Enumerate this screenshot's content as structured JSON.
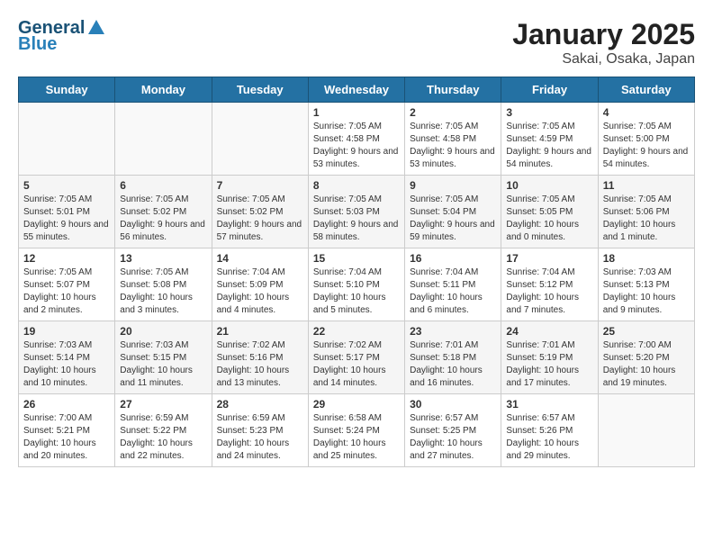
{
  "header": {
    "logo_line1": "General",
    "logo_line2": "Blue",
    "title": "January 2025",
    "subtitle": "Sakai, Osaka, Japan"
  },
  "days_of_week": [
    "Sunday",
    "Monday",
    "Tuesday",
    "Wednesday",
    "Thursday",
    "Friday",
    "Saturday"
  ],
  "weeks": [
    [
      {
        "day": "",
        "sunrise": "",
        "sunset": "",
        "daylight": ""
      },
      {
        "day": "",
        "sunrise": "",
        "sunset": "",
        "daylight": ""
      },
      {
        "day": "",
        "sunrise": "",
        "sunset": "",
        "daylight": ""
      },
      {
        "day": "1",
        "sunrise": "Sunrise: 7:05 AM",
        "sunset": "Sunset: 4:58 PM",
        "daylight": "Daylight: 9 hours and 53 minutes."
      },
      {
        "day": "2",
        "sunrise": "Sunrise: 7:05 AM",
        "sunset": "Sunset: 4:58 PM",
        "daylight": "Daylight: 9 hours and 53 minutes."
      },
      {
        "day": "3",
        "sunrise": "Sunrise: 7:05 AM",
        "sunset": "Sunset: 4:59 PM",
        "daylight": "Daylight: 9 hours and 54 minutes."
      },
      {
        "day": "4",
        "sunrise": "Sunrise: 7:05 AM",
        "sunset": "Sunset: 5:00 PM",
        "daylight": "Daylight: 9 hours and 54 minutes."
      }
    ],
    [
      {
        "day": "5",
        "sunrise": "Sunrise: 7:05 AM",
        "sunset": "Sunset: 5:01 PM",
        "daylight": "Daylight: 9 hours and 55 minutes."
      },
      {
        "day": "6",
        "sunrise": "Sunrise: 7:05 AM",
        "sunset": "Sunset: 5:02 PM",
        "daylight": "Daylight: 9 hours and 56 minutes."
      },
      {
        "day": "7",
        "sunrise": "Sunrise: 7:05 AM",
        "sunset": "Sunset: 5:02 PM",
        "daylight": "Daylight: 9 hours and 57 minutes."
      },
      {
        "day": "8",
        "sunrise": "Sunrise: 7:05 AM",
        "sunset": "Sunset: 5:03 PM",
        "daylight": "Daylight: 9 hours and 58 minutes."
      },
      {
        "day": "9",
        "sunrise": "Sunrise: 7:05 AM",
        "sunset": "Sunset: 5:04 PM",
        "daylight": "Daylight: 9 hours and 59 minutes."
      },
      {
        "day": "10",
        "sunrise": "Sunrise: 7:05 AM",
        "sunset": "Sunset: 5:05 PM",
        "daylight": "Daylight: 10 hours and 0 minutes."
      },
      {
        "day": "11",
        "sunrise": "Sunrise: 7:05 AM",
        "sunset": "Sunset: 5:06 PM",
        "daylight": "Daylight: 10 hours and 1 minute."
      }
    ],
    [
      {
        "day": "12",
        "sunrise": "Sunrise: 7:05 AM",
        "sunset": "Sunset: 5:07 PM",
        "daylight": "Daylight: 10 hours and 2 minutes."
      },
      {
        "day": "13",
        "sunrise": "Sunrise: 7:05 AM",
        "sunset": "Sunset: 5:08 PM",
        "daylight": "Daylight: 10 hours and 3 minutes."
      },
      {
        "day": "14",
        "sunrise": "Sunrise: 7:04 AM",
        "sunset": "Sunset: 5:09 PM",
        "daylight": "Daylight: 10 hours and 4 minutes."
      },
      {
        "day": "15",
        "sunrise": "Sunrise: 7:04 AM",
        "sunset": "Sunset: 5:10 PM",
        "daylight": "Daylight: 10 hours and 5 minutes."
      },
      {
        "day": "16",
        "sunrise": "Sunrise: 7:04 AM",
        "sunset": "Sunset: 5:11 PM",
        "daylight": "Daylight: 10 hours and 6 minutes."
      },
      {
        "day": "17",
        "sunrise": "Sunrise: 7:04 AM",
        "sunset": "Sunset: 5:12 PM",
        "daylight": "Daylight: 10 hours and 7 minutes."
      },
      {
        "day": "18",
        "sunrise": "Sunrise: 7:03 AM",
        "sunset": "Sunset: 5:13 PM",
        "daylight": "Daylight: 10 hours and 9 minutes."
      }
    ],
    [
      {
        "day": "19",
        "sunrise": "Sunrise: 7:03 AM",
        "sunset": "Sunset: 5:14 PM",
        "daylight": "Daylight: 10 hours and 10 minutes."
      },
      {
        "day": "20",
        "sunrise": "Sunrise: 7:03 AM",
        "sunset": "Sunset: 5:15 PM",
        "daylight": "Daylight: 10 hours and 11 minutes."
      },
      {
        "day": "21",
        "sunrise": "Sunrise: 7:02 AM",
        "sunset": "Sunset: 5:16 PM",
        "daylight": "Daylight: 10 hours and 13 minutes."
      },
      {
        "day": "22",
        "sunrise": "Sunrise: 7:02 AM",
        "sunset": "Sunset: 5:17 PM",
        "daylight": "Daylight: 10 hours and 14 minutes."
      },
      {
        "day": "23",
        "sunrise": "Sunrise: 7:01 AM",
        "sunset": "Sunset: 5:18 PM",
        "daylight": "Daylight: 10 hours and 16 minutes."
      },
      {
        "day": "24",
        "sunrise": "Sunrise: 7:01 AM",
        "sunset": "Sunset: 5:19 PM",
        "daylight": "Daylight: 10 hours and 17 minutes."
      },
      {
        "day": "25",
        "sunrise": "Sunrise: 7:00 AM",
        "sunset": "Sunset: 5:20 PM",
        "daylight": "Daylight: 10 hours and 19 minutes."
      }
    ],
    [
      {
        "day": "26",
        "sunrise": "Sunrise: 7:00 AM",
        "sunset": "Sunset: 5:21 PM",
        "daylight": "Daylight: 10 hours and 20 minutes."
      },
      {
        "day": "27",
        "sunrise": "Sunrise: 6:59 AM",
        "sunset": "Sunset: 5:22 PM",
        "daylight": "Daylight: 10 hours and 22 minutes."
      },
      {
        "day": "28",
        "sunrise": "Sunrise: 6:59 AM",
        "sunset": "Sunset: 5:23 PM",
        "daylight": "Daylight: 10 hours and 24 minutes."
      },
      {
        "day": "29",
        "sunrise": "Sunrise: 6:58 AM",
        "sunset": "Sunset: 5:24 PM",
        "daylight": "Daylight: 10 hours and 25 minutes."
      },
      {
        "day": "30",
        "sunrise": "Sunrise: 6:57 AM",
        "sunset": "Sunset: 5:25 PM",
        "daylight": "Daylight: 10 hours and 27 minutes."
      },
      {
        "day": "31",
        "sunrise": "Sunrise: 6:57 AM",
        "sunset": "Sunset: 5:26 PM",
        "daylight": "Daylight: 10 hours and 29 minutes."
      },
      {
        "day": "",
        "sunrise": "",
        "sunset": "",
        "daylight": ""
      }
    ]
  ]
}
